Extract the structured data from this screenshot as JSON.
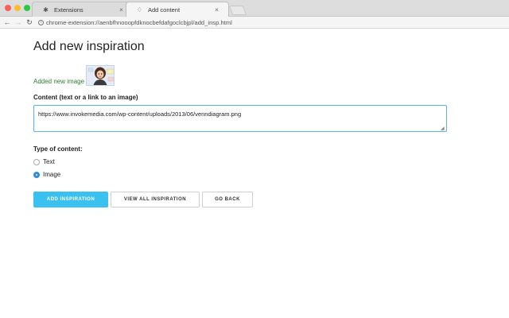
{
  "browser": {
    "tabs": [
      {
        "title": "Extensions",
        "icon": "puzzle-icon",
        "active": false
      },
      {
        "title": "Add content",
        "icon": "bulb-icon",
        "active": true
      }
    ],
    "close_glyph": "×",
    "url": "chrome-extension://aenbfhnooopfdknocbefdafgoclcbjpl/add_insp.html"
  },
  "page": {
    "title": "Add new inspiration",
    "added_text": "Added new image",
    "content_label": "Content (text or a link to an image)",
    "content_value": "https://www.invokemedia.com/wp-content/uploads/2013/06/venndiagram.png",
    "type_label": "Type of content:",
    "options": [
      {
        "label": "Text",
        "checked": false
      },
      {
        "label": "Image",
        "checked": true
      }
    ],
    "buttons": {
      "add": "ADD INSPIRATION",
      "view_all": "VIEW ALL INSPIRATION",
      "go_back": "GO BACK"
    }
  },
  "colors": {
    "accent": "#3ac1f0",
    "added_text": "#2e7d32",
    "input_focus": "#5fb3ea"
  }
}
